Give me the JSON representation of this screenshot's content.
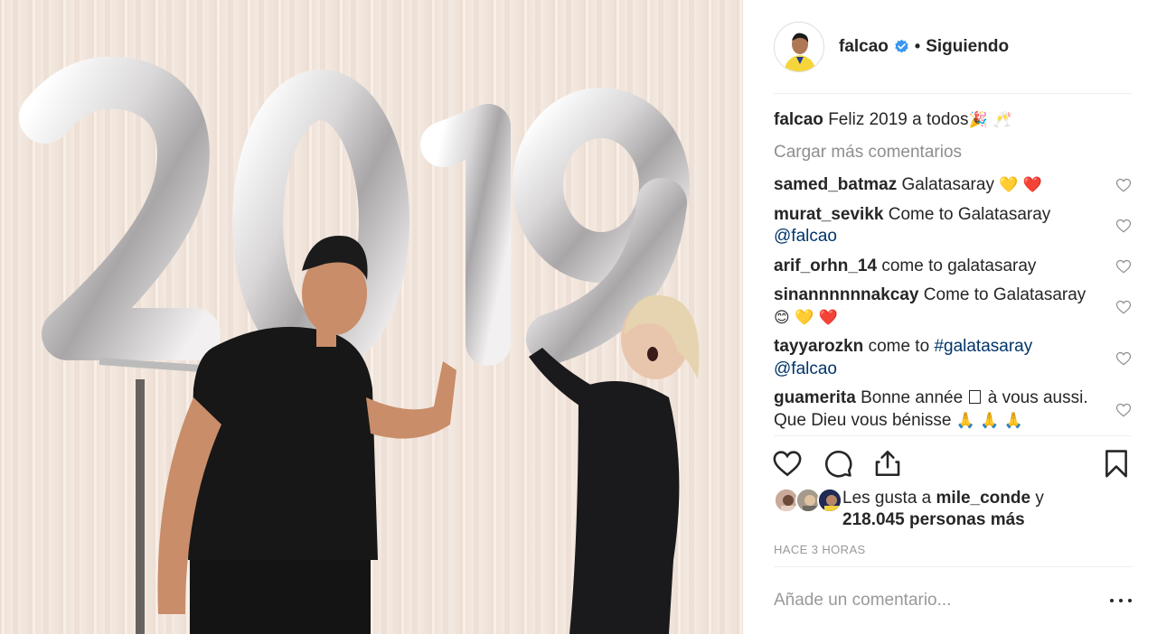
{
  "post": {
    "owner": "falcao",
    "follow_separator": "•",
    "follow_label": "Siguiendo",
    "caption": {
      "user": "falcao",
      "text": "Feliz 2019 a todos",
      "emoji": "🎉 🥂"
    },
    "load_more": "Cargar más comentarios",
    "comments": [
      {
        "user": "samed_batmaz",
        "text": "Galatasaray",
        "emoji": "💛 ❤️"
      },
      {
        "user": "murat_sevikk",
        "text": "Come to Galatasaray",
        "mention": "@falcao"
      },
      {
        "user": "arif_orhn_14",
        "text": "come to galatasaray"
      },
      {
        "user": "sinannnnnnakcay",
        "text": "Come to Galatasaray",
        "emoji": "😊 💛 ❤️"
      },
      {
        "user": "tayyarozkn",
        "text": "come to",
        "hashtag": "#galatasaray",
        "mention": "@falcao"
      },
      {
        "user": "guamerita",
        "text_a": "Bonne année",
        "text_b": "à vous aussi.",
        "text_c": "Que Dieu vous bénisse",
        "emoji": "🙏 🙏 🙏"
      }
    ],
    "likes": {
      "prefix": "Les gusta a",
      "user": "mile_conde",
      "connector": "y",
      "others": "218.045 personas más"
    },
    "timestamp": "HACE 3 HORAS",
    "add_comment_placeholder": "Añade un comentario...",
    "photo_text": "2019",
    "icons": [
      "heart-icon",
      "comment-icon",
      "share-icon",
      "bookmark-icon",
      "verified-badge-icon",
      "more-options-icon"
    ],
    "colors": {
      "mention": "#003569",
      "muted": "#8e8e8e",
      "verified": "#3897f0"
    }
  }
}
